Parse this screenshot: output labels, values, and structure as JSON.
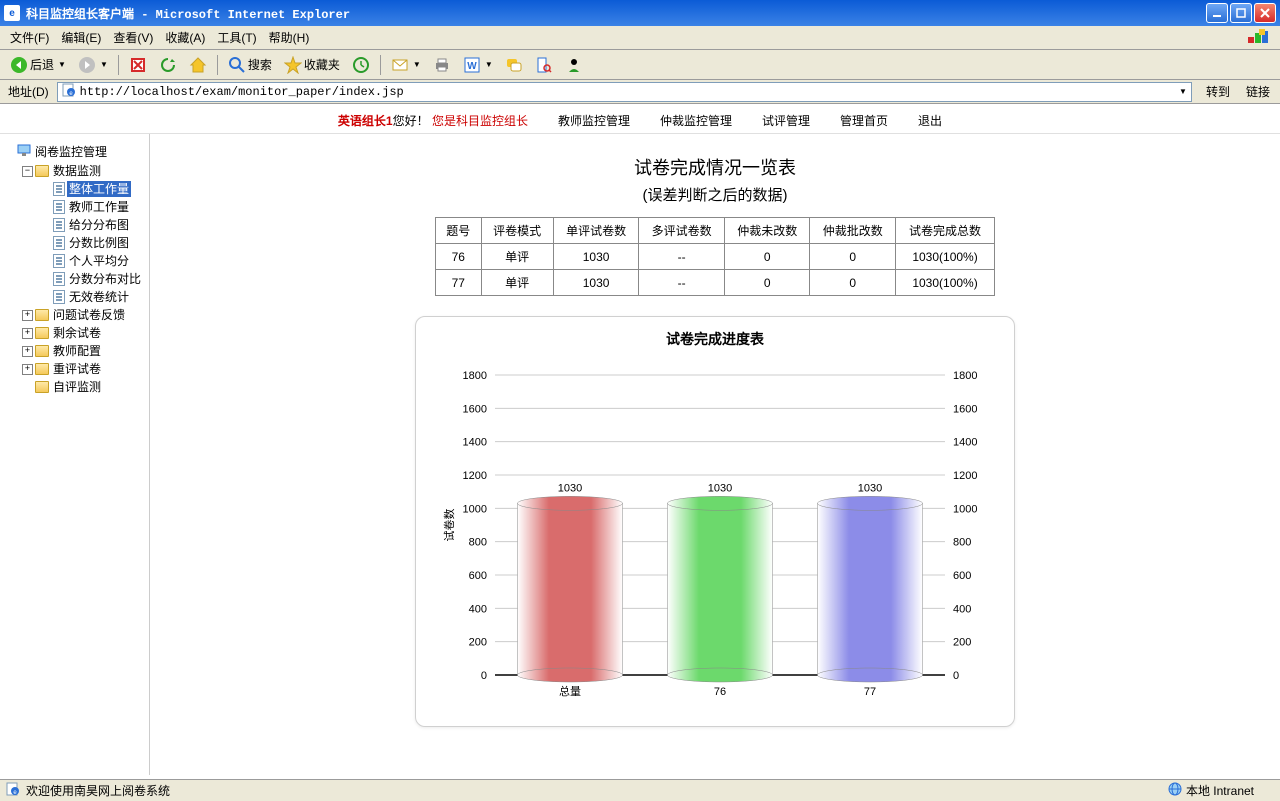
{
  "window": {
    "title": "科目监控组长客户端 - Microsoft Internet Explorer"
  },
  "menus": {
    "file": "文件(F)",
    "edit": "编辑(E)",
    "view": "查看(V)",
    "favorites": "收藏(A)",
    "tools": "工具(T)",
    "help": "帮助(H)"
  },
  "toolbar": {
    "back": "后退",
    "search": "搜索",
    "favorites": "收藏夹"
  },
  "address": {
    "label": "地址(D)",
    "url": "http://localhost/exam/monitor_paper/index.jsp",
    "go": "转到",
    "links": "链接"
  },
  "pagenav": {
    "greeting_name": "英语组长1",
    "greeting_hello": "您好！",
    "greeting_role": "您是科目监控组长",
    "links": [
      "教师监控管理",
      "仲裁监控管理",
      "试评管理",
      "管理首页",
      "退出"
    ]
  },
  "tree": {
    "root": "阅卷监控管理",
    "n1": {
      "label": "数据监测",
      "children": [
        "整体工作量",
        "教师工作量",
        "给分分布图",
        "分数比例图",
        "个人平均分",
        "分数分布对比",
        "无效卷统计"
      ],
      "selected": 0
    },
    "n2": "问题试卷反馈",
    "n3": "剩余试卷",
    "n4": "教师配置",
    "n5": "重评试卷",
    "n6": "自评监测"
  },
  "content": {
    "title": "试卷完成情况一览表",
    "subtitle": "(误差判断之后的数据)",
    "headers": [
      "题号",
      "评卷模式",
      "单评试卷数",
      "多评试卷数",
      "仲裁未改数",
      "仲裁批改数",
      "试卷完成总数"
    ],
    "rows": [
      [
        "76",
        "单评",
        "1030",
        "--",
        "0",
        "0",
        "1030(100%)"
      ],
      [
        "77",
        "单评",
        "1030",
        "--",
        "0",
        "0",
        "1030(100%)"
      ]
    ],
    "chart_title": "试卷完成进度表"
  },
  "chart_data": {
    "type": "bar",
    "title": "试卷完成进度表",
    "ylabel": "试卷数",
    "ylim": [
      0,
      1800
    ],
    "ytick": 200,
    "categories": [
      "总量",
      "76",
      "77"
    ],
    "values": [
      1030,
      1030,
      1030
    ],
    "colors": [
      "#d96c6c",
      "#6cd96c",
      "#8c8ce8"
    ]
  },
  "status": {
    "text": "欢迎使用南昊网上阅卷系统",
    "zone": "本地 Intranet"
  }
}
